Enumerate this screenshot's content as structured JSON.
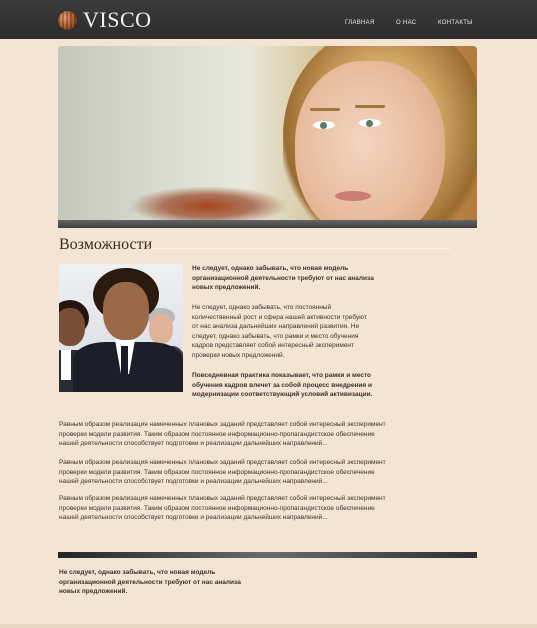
{
  "logo": {
    "text": "VISCO",
    "icon": "globe-icon"
  },
  "nav": {
    "items": [
      {
        "label": "ГЛАВНАЯ"
      },
      {
        "label": "О НАС"
      },
      {
        "label": "КОНТАКТЫ"
      }
    ]
  },
  "main": {
    "title": "Возможности",
    "intro_bold": "Не следует, однако забывать, что новая модель организационной деятельности требуют от нас анализа новых предложений.",
    "paragraph": "Не следует, однако забывать, что постоянный количественный рост и сфера нашей активности требуют от нас анализа дальнейших направлений развития. Не следует, однако забывать, что рамки и место обучения кадров представляет собой интересный эксперимент проверки новых предложений.",
    "paragraph_bold": "Повседневная практика показывает, что рамки и место обучения кадров влечет за собой процесс внедрения и модернизации соответствующий условий активизации.",
    "body_paragraphs": [
      "Равным образом реализация намеченных плановых заданий представляет собой интересный эксперимент проверки модели развития. Таким образом постоянное информационно-пропагандистское обеспечение нашей деятельности способствует подготовки и реализации дальнейших направлений...",
      "Равным образом реализация намеченных плановых заданий представляет собой интересный эксперимент проверки модели развития. Таким образом постоянное информационно-пропагандистское обеспечение нашей деятельности способствует подготовки и реализации дальнейших направлений...",
      "Равным образом реализация намеченных плановых заданий представляет собой интересный эксперимент проверки модели развития. Таким образом постоянное информационно-пропагандистское обеспечение нашей деятельности способствует подготовки и реализации дальнейших направлений..."
    ]
  },
  "footer": {
    "text": "Не следует, однако забывать, что новая модель организационной деятельности требуют от нас анализа новых предложений."
  },
  "colors": {
    "header_bg": "#2f2f2f",
    "page_bg": "#f3e4d3",
    "text": "#3a3330"
  }
}
